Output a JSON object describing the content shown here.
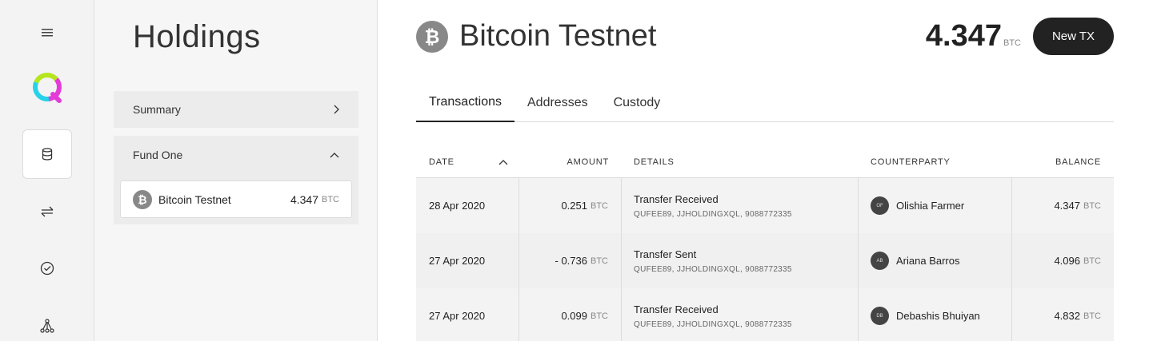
{
  "rail": {
    "icons": [
      "menu-icon",
      "app-logo",
      "holdings-icon",
      "transfer-icon",
      "check-circle-icon",
      "network-icon"
    ],
    "colors": {
      "logo_green": "#b5e61d",
      "logo_magenta": "#e33ad8",
      "logo_cyan": "#26d2e8"
    }
  },
  "panel": {
    "title": "Holdings",
    "summary_label": "Summary",
    "fund_label": "Fund One",
    "asset": {
      "name": "Bitcoin Testnet",
      "amount": "4.347",
      "unit": "BTC"
    }
  },
  "main": {
    "title": "Bitcoin Testnet",
    "balance": "4.347",
    "balance_unit": "BTC",
    "new_tx_label": "New TX",
    "tabs": [
      {
        "label": "Transactions",
        "active": true
      },
      {
        "label": "Addresses",
        "active": false
      },
      {
        "label": "Custody",
        "active": false
      }
    ]
  },
  "table": {
    "headers": {
      "date": "DATE",
      "amount": "AMOUNT",
      "details": "DETAILS",
      "counterparty": "COUNTERPARTY",
      "balance": "BALANCE"
    },
    "rows": [
      {
        "date": "28 Apr 2020",
        "amount": "0.251",
        "unit": "BTC",
        "details": "Transfer Received",
        "details_sub": "QUFEE89, JJHOLDINGXQL, 9088772335",
        "initials": "OF",
        "counterparty": "Olishia Farmer",
        "balance": "4.347",
        "balance_unit": "BTC"
      },
      {
        "date": "27 Apr 2020",
        "amount": "- 0.736",
        "unit": "BTC",
        "details": "Transfer Sent",
        "details_sub": "QUFEE89, JJHOLDINGXQL, 9088772335",
        "initials": "AB",
        "counterparty": "Ariana Barros",
        "balance": "4.096",
        "balance_unit": "BTC"
      },
      {
        "date": "27 Apr 2020",
        "amount": "0.099",
        "unit": "BTC",
        "details": "Transfer Received",
        "details_sub": "QUFEE89, JJHOLDINGXQL, 9088772335",
        "initials": "DB",
        "counterparty": "Debashis Bhuiyan",
        "balance": "4.832",
        "balance_unit": "BTC"
      }
    ]
  }
}
